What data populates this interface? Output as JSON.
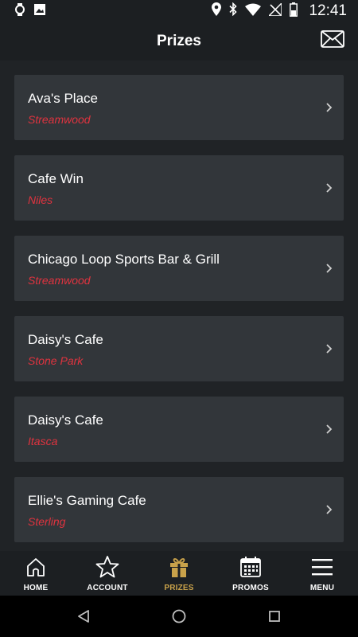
{
  "status_bar": {
    "time": "12:41"
  },
  "header": {
    "title": "Prizes"
  },
  "prizes": [
    {
      "name": "Ava's Place",
      "city": "Streamwood"
    },
    {
      "name": "Cafe Win",
      "city": "Niles"
    },
    {
      "name": "Chicago Loop Sports Bar & Grill",
      "city": "Streamwood"
    },
    {
      "name": "Daisy's Cafe",
      "city": "Stone Park"
    },
    {
      "name": "Daisy's Cafe",
      "city": "Itasca"
    },
    {
      "name": "Ellie's Gaming Cafe",
      "city": "Sterling"
    }
  ],
  "bottom_nav": {
    "items": [
      {
        "label": "HOME",
        "icon": "home-icon",
        "active": false
      },
      {
        "label": "ACCOUNT",
        "icon": "star-icon",
        "active": false
      },
      {
        "label": "PRIZES",
        "icon": "gift-icon",
        "active": true
      },
      {
        "label": "PROMOS",
        "icon": "calendar-icon",
        "active": false
      },
      {
        "label": "MENU",
        "icon": "hamburger-icon",
        "active": false
      }
    ],
    "active_color": "#c9a24a",
    "inactive_color": "#ffffff"
  },
  "colors": {
    "city_text": "#e0333f",
    "card_bg": "#32363a",
    "background": "#1c1f22"
  }
}
